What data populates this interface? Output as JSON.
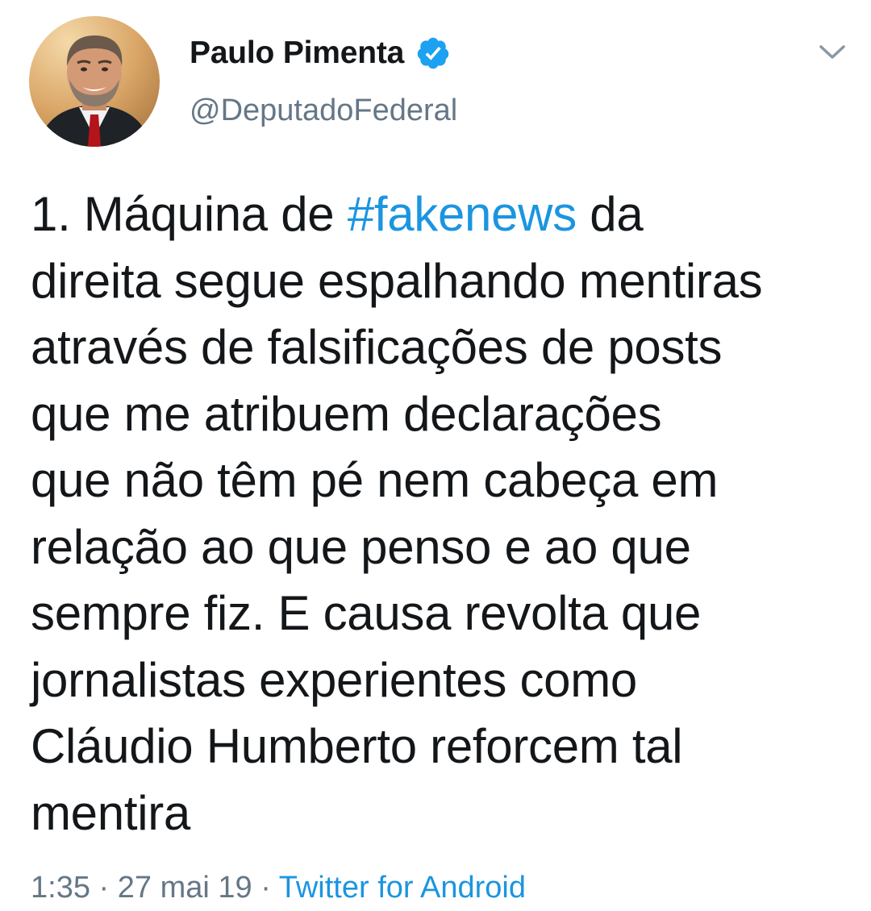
{
  "author": {
    "display_name": "Paulo Pimenta",
    "handle": "@DeputadoFederal",
    "verified": true,
    "verified_icon": "verified-badge-icon",
    "avatar_icon": "profile-photo"
  },
  "menu": {
    "icon": "chevron-down-icon"
  },
  "tweet": {
    "lines": [
      {
        "before": "1. Máquina de ",
        "hashtag": "#fakenews",
        "after": " da"
      },
      {
        "text": "direita segue espalhando mentiras"
      },
      {
        "text": "através de falsificações de posts"
      },
      {
        "text": "que me atribuem declarações"
      },
      {
        "text": "que não têm pé nem cabeça em"
      },
      {
        "text": "relação ao que penso e ao que"
      },
      {
        "text": "sempre fiz. E causa revolta que"
      },
      {
        "text": "jornalistas experientes como"
      },
      {
        "text": "Cláudio Humberto reforcem tal"
      },
      {
        "text": "mentira"
      }
    ]
  },
  "meta": {
    "time": "1:35",
    "separator": " · ",
    "date": "27 mai 19",
    "source": "Twitter for Android"
  },
  "colors": {
    "link": "#1b95e0",
    "secondary_text": "#657786",
    "primary_text": "#14171a",
    "verified": "#1da1f2"
  }
}
